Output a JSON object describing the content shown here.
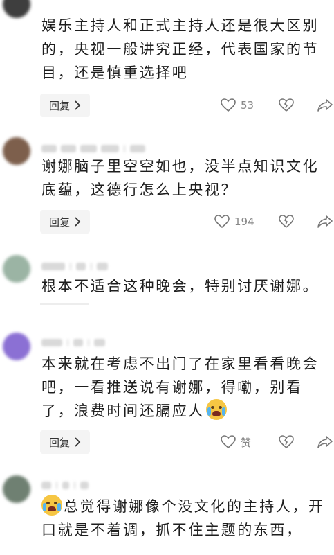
{
  "comments": [
    {
      "text": "娱乐主持人和正式主持人还是很大区别的，央视一般讲究正经，代表国家的节目，还是慎重选择吧",
      "reply_label": "回复",
      "likes": "53",
      "avatar_color": "#4a4a4a"
    },
    {
      "text": "谢娜脑子里空空如也，没半点知识文化底蕴，这德行怎么上央视？",
      "reply_label": "回复",
      "likes": "194",
      "avatar_color": "#8a6a54"
    },
    {
      "text": "根本不适合这种晚会，特别讨厌谢娜。",
      "avatar_color": "#9fb6a6"
    },
    {
      "text": "本来就在考虑不出门了在家里看看晚会吧，一看推送说有谢娜，得嘞，别看了，浪费时间还膈应人",
      "reply_label": "回复",
      "likes": "赞",
      "emoji": "crying-face-emoji",
      "avatar_color": "#8c6fd6"
    },
    {
      "text": "总觉得谢娜像个没文化的主持人，开口就是不着调，抓不住主题的东西，",
      "emoji": "crying-face-emoji",
      "avatar_color": "#6b7c6e"
    }
  ]
}
